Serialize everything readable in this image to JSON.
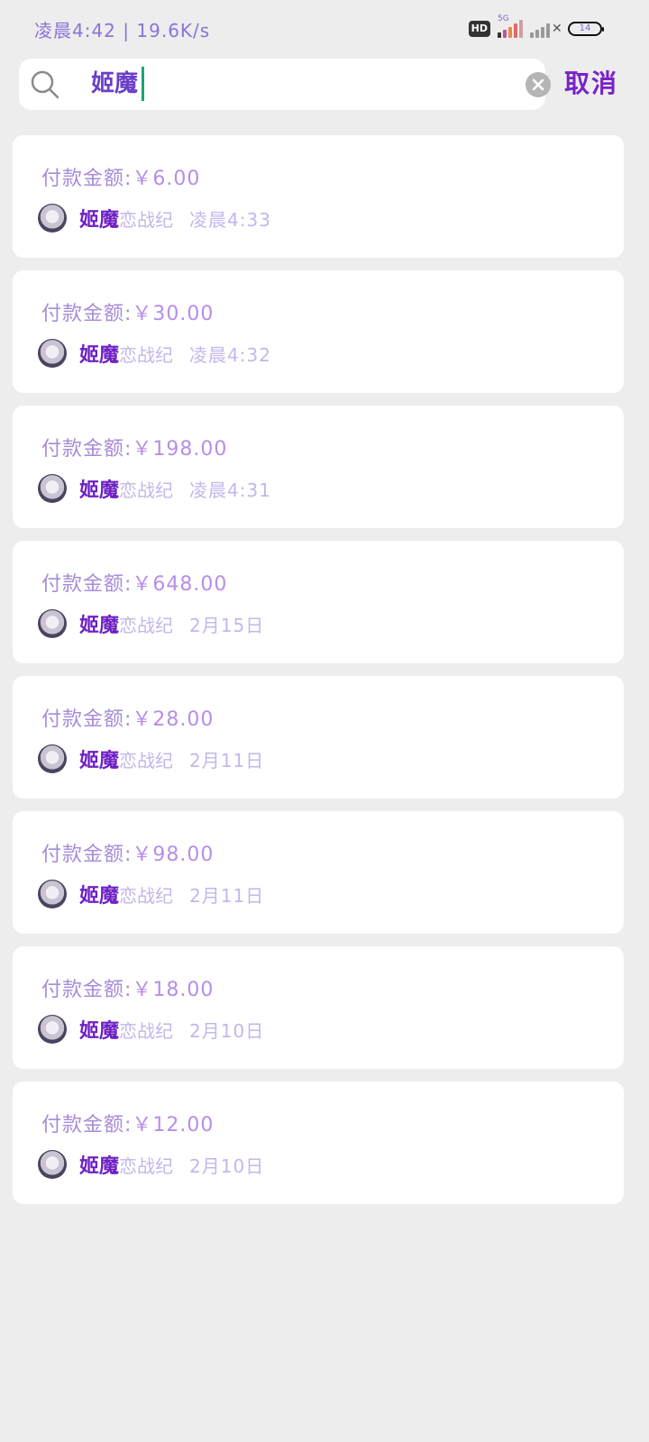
{
  "status": {
    "time": "凌晨4:42",
    "speed": "19.6K/s",
    "hd": "HD",
    "network": "5G",
    "battery": "14"
  },
  "search": {
    "query": "姬魔",
    "cancel_label": "取消"
  },
  "colors": {
    "accent": "#7a22c8",
    "caret": "#1aa37a",
    "background": "#ededed"
  },
  "results": [
    {
      "amount_label": "付款金额:",
      "amount": "￥6.00",
      "app_name": "姬魔",
      "app_name_rest": "恋战纪",
      "time": "凌晨4:33"
    },
    {
      "amount_label": "付款金额:",
      "amount": "￥30.00",
      "app_name": "姬魔",
      "app_name_rest": "恋战纪",
      "time": "凌晨4:32"
    },
    {
      "amount_label": "付款金额:",
      "amount": "￥198.00",
      "app_name": "姬魔",
      "app_name_rest": "恋战纪",
      "time": "凌晨4:31"
    },
    {
      "amount_label": "付款金额:",
      "amount": "￥648.00",
      "app_name": "姬魔",
      "app_name_rest": "恋战纪",
      "time": "2月15日"
    },
    {
      "amount_label": "付款金额:",
      "amount": "￥28.00",
      "app_name": "姬魔",
      "app_name_rest": "恋战纪",
      "time": "2月11日"
    },
    {
      "amount_label": "付款金额:",
      "amount": "￥98.00",
      "app_name": "姬魔",
      "app_name_rest": "恋战纪",
      "time": "2月11日"
    },
    {
      "amount_label": "付款金额:",
      "amount": "￥18.00",
      "app_name": "姬魔",
      "app_name_rest": "恋战纪",
      "time": "2月10日"
    },
    {
      "amount_label": "付款金额:",
      "amount": "￥12.00",
      "app_name": "姬魔",
      "app_name_rest": "恋战纪",
      "time": "2月10日"
    }
  ]
}
